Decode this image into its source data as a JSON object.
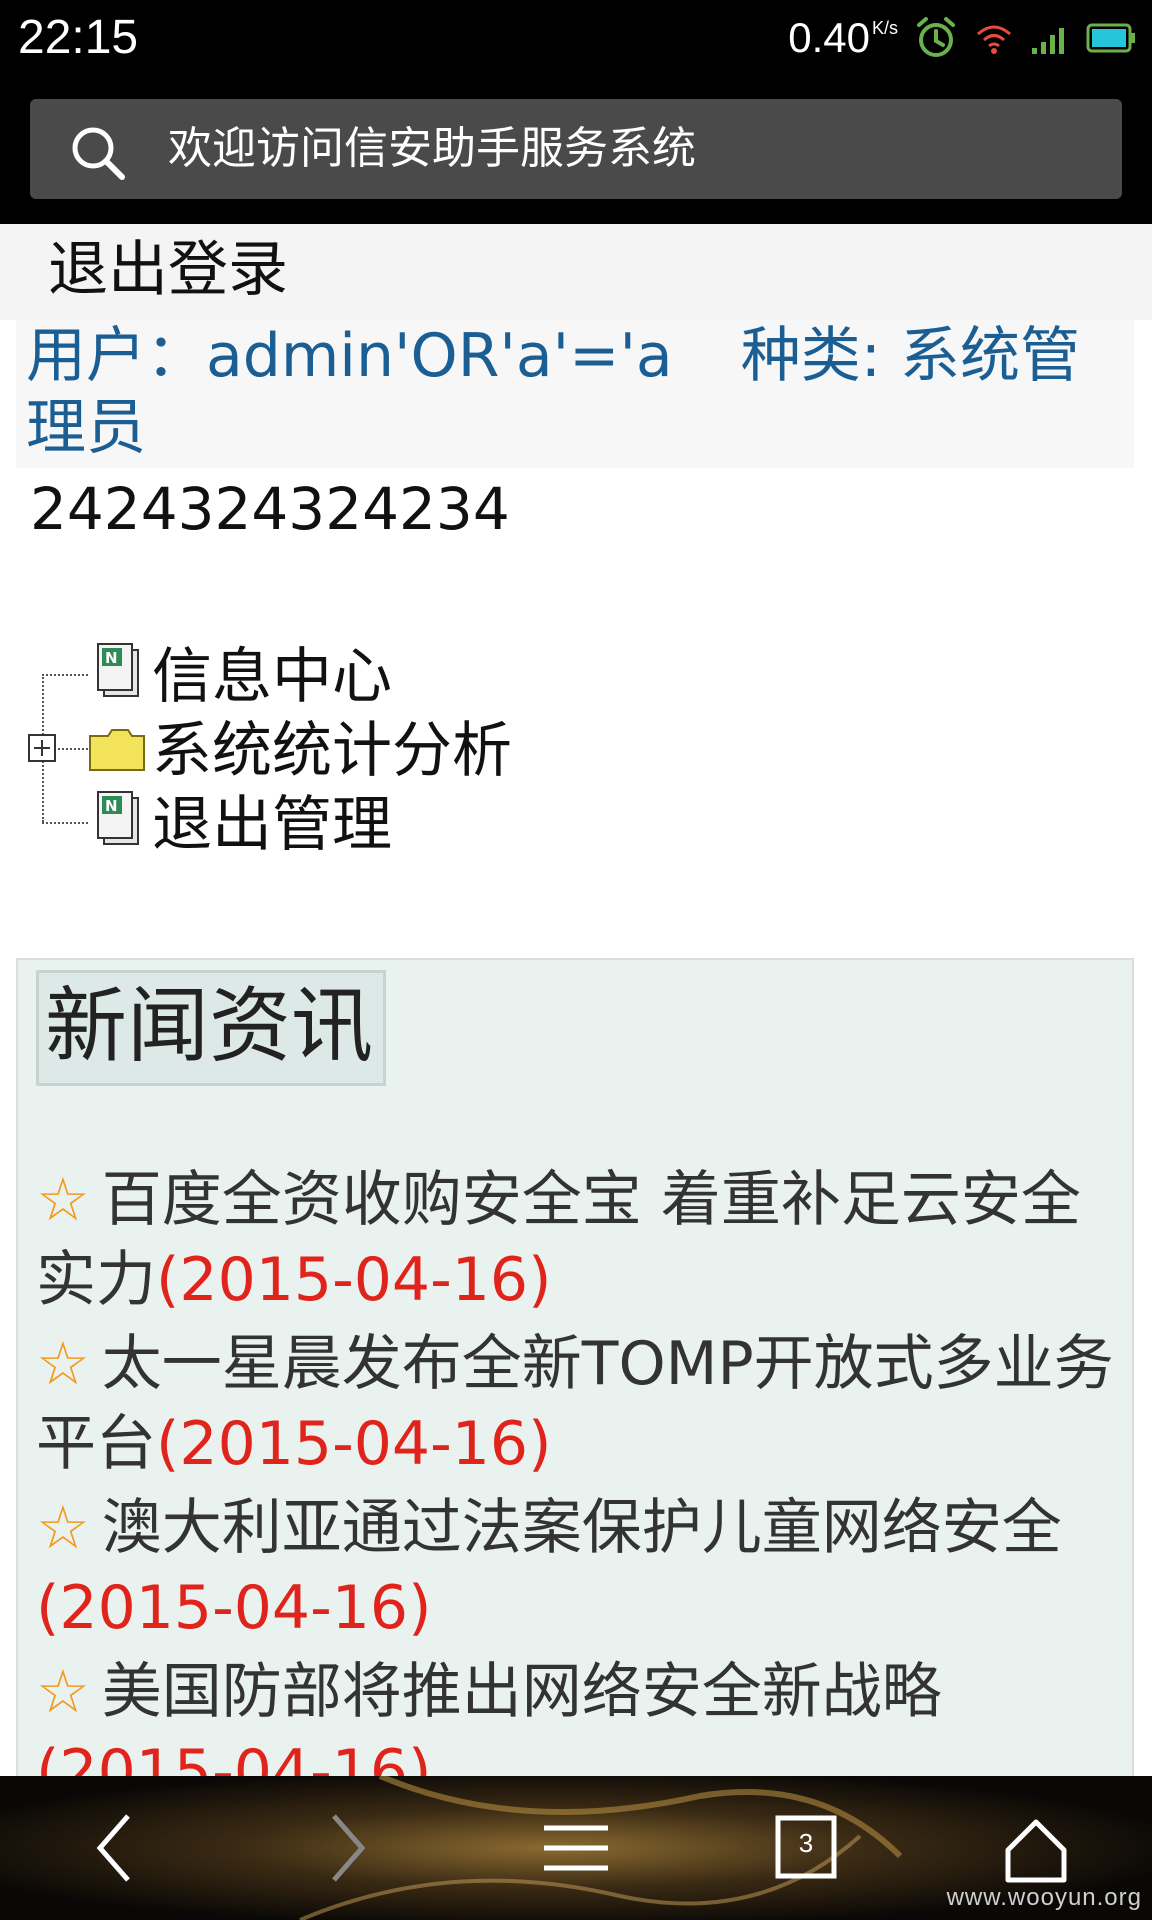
{
  "status_bar": {
    "time": "22:15",
    "net_speed": "0.40",
    "net_speed_unit": "K/s",
    "icons": [
      "alarm-icon",
      "wifi-icon",
      "signal-icon",
      "battery-icon"
    ],
    "accent_color": "#6ab04c"
  },
  "browser": {
    "search_text": "欢迎访问信安助手服务系统"
  },
  "page": {
    "logout_link": "退出登录",
    "user_label": "用户：",
    "user_value": "admin'OR'a'='a",
    "type_label": "种类: ",
    "type_value": "系统管理员",
    "id_number": "2424324324234",
    "tree": [
      {
        "label": "信息中心",
        "icon": "document-icon"
      },
      {
        "label": "系统统计分析",
        "icon": "folder-icon",
        "expandable": true
      },
      {
        "label": "退出管理",
        "icon": "document-icon"
      }
    ]
  },
  "news": {
    "title": "新闻资讯",
    "items": [
      {
        "star": "☆",
        "text": "百度全资收购安全宝 着重补足云安全实力",
        "date": "(2015-04-16)"
      },
      {
        "star": "☆",
        "text": "太一星晨发布全新TOMP开放式多业务平台",
        "date": "(2015-04-16)"
      },
      {
        "star": "☆",
        "text": "澳大利亚通过法案保护儿童网络安全",
        "date": "(2015-04-16)"
      },
      {
        "star": "☆",
        "text": "美国防部将推出网络安全新战略",
        "date": "(2015-04-16)"
      }
    ],
    "colors": {
      "link": "#1a5e94",
      "star": "#f39a1d",
      "date": "#e0231b"
    }
  },
  "nav_bar": {
    "tab_count": "3",
    "watermark": "www.wooyun.org"
  }
}
